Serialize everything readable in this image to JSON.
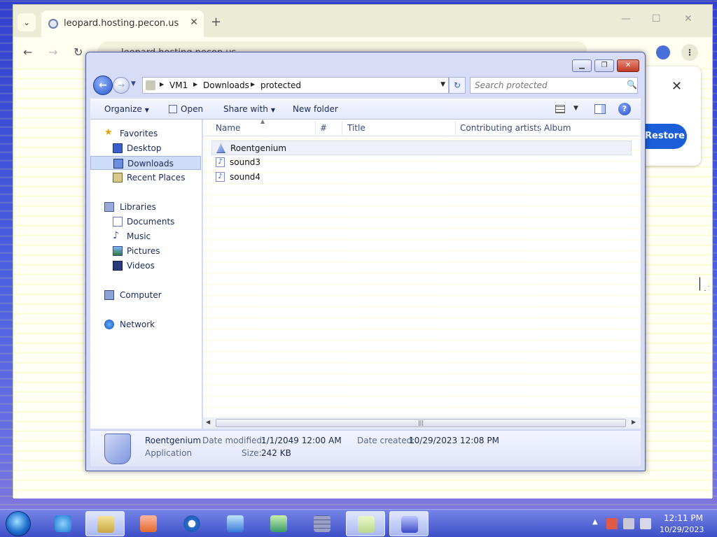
{
  "browser": {
    "tab_title": "leopard.hosting.pecon.us",
    "url": "leopard.hosting.pecon.us",
    "restore_label": "Restore"
  },
  "explorer": {
    "breadcrumb": [
      "VM1",
      "Downloads",
      "protected"
    ],
    "search_placeholder": "Search protected",
    "commands": {
      "organize": "Organize",
      "open": "Open",
      "share_with": "Share with",
      "new_folder": "New folder"
    },
    "nav": {
      "favorites": "Favorites",
      "desktop": "Desktop",
      "downloads": "Downloads",
      "recent_places": "Recent Places",
      "libraries": "Libraries",
      "documents": "Documents",
      "music": "Music",
      "pictures": "Pictures",
      "videos": "Videos",
      "computer": "Computer",
      "network": "Network"
    },
    "columns": [
      "Name",
      "#",
      "Title",
      "Contributing artists",
      "Album"
    ],
    "files": [
      {
        "name": "Roentgenium",
        "type": "app"
      },
      {
        "name": "sound3",
        "type": "audio"
      },
      {
        "name": "sound4",
        "type": "audio"
      }
    ],
    "details": {
      "name": "Roentgenium",
      "type": "Application",
      "date_modified_label": "Date modified:",
      "date_modified": "1/1/2049 12:00 AM",
      "date_created_label": "Date created:",
      "date_created": "10/29/2023 12:08 PM",
      "size_label": "Size:",
      "size": "242 KB"
    }
  },
  "taskbar": {
    "time": "12:11 PM",
    "date": "10/29/2023"
  }
}
